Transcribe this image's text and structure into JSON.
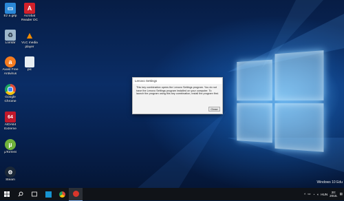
{
  "desktop_icons": [
    {
      "label": "Ez a gép",
      "icon": "computer-icon",
      "color": "#2b88d8"
    },
    {
      "label": "Acrobat Reader DC",
      "icon": "acrobat-icon",
      "color": "#d1202a"
    },
    {
      "label": "Lomtár",
      "icon": "recycle-bin-icon",
      "color": "#9fb8cc"
    },
    {
      "label": "VLC media player",
      "icon": "vlc-icon",
      "color": "#f08a00"
    },
    {
      "label": "Avast Free Antivirus",
      "icon": "avast-icon",
      "color": "#f57c20"
    },
    {
      "label": "pic",
      "icon": "file-icon",
      "color": "#e8eef3"
    },
    {
      "label": "Google Chrome",
      "icon": "chrome-icon",
      "color": "#dd4b39"
    },
    {
      "label": "AIDA64 Extreme",
      "icon": "aida64-icon",
      "color": "#c0182b"
    },
    {
      "label": "µTorrent",
      "icon": "utorrent-icon",
      "color": "#6fb23b"
    },
    {
      "label": "Steam",
      "icon": "steam-icon",
      "color": "#1b2838"
    }
  ],
  "dialog": {
    "title": "Lenovo Settings",
    "message": "This key combination opens the Lenovo Settings program. You do not have the Lenovo Settings program installed on your computer. To launch the program using this key combination, install the program first.",
    "close_label": "Close"
  },
  "taskbar": {
    "icons": [
      "windows-start-icon",
      "search-icon",
      "task-view-icon",
      "store-icon",
      "chrome-icon",
      "app-icon"
    ],
    "language": "HUN",
    "time": "20:",
    "date": "2015.",
    "watermark": "Windows 10 Edu"
  }
}
